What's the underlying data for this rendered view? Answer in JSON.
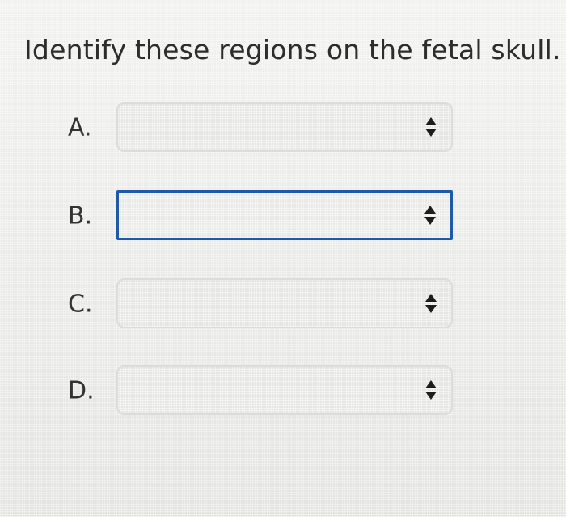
{
  "question": {
    "text": "Identify these regions on the fetal skull."
  },
  "dropdowns": [
    {
      "label": "A.",
      "selected": "",
      "focused": false
    },
    {
      "label": "B.",
      "selected": "",
      "focused": true
    },
    {
      "label": "C.",
      "selected": "",
      "focused": false
    },
    {
      "label": "D.",
      "selected": "",
      "focused": false
    }
  ],
  "icons": {
    "dropdown_arrows": "up-down-arrows-icon"
  },
  "colors": {
    "focus_border": "#1f5aa8",
    "text": "#2d2d2d",
    "select_background": "#e6e6e4"
  }
}
